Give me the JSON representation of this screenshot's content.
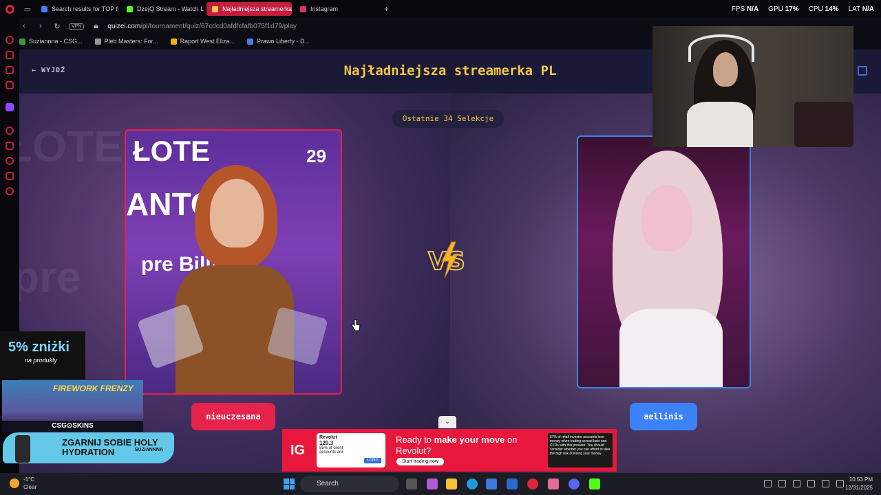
{
  "browser": {
    "tabs": [
      {
        "label": "Search results for TOP fe…",
        "color": "#4f7cff",
        "active": false
      },
      {
        "label": "DzejQ Stream - Watch Liv…",
        "color": "#53fc18",
        "active": false
      },
      {
        "label": "Najładniejsza streamerka…",
        "color": "#f6c64a",
        "active": true
      },
      {
        "label": "Instagram",
        "color": "#e1306c",
        "active": false
      }
    ],
    "new_tab": "+",
    "perf": {
      "fps_label": "FPS",
      "fps": "N/A",
      "gpu_label": "GPU",
      "gpu": "17%",
      "cpu_label": "CPU",
      "cpu": "14%",
      "lat_label": "LAT",
      "lat": "N/A"
    },
    "vpn": "VPN",
    "url_domain": "quizei.com",
    "url_path": "/pl/tournament/quiz/67cdcd0afdfcfafb075f1d79/play",
    "bookmarks": [
      {
        "label": "Suziannna - CSG...",
        "color": "#3a9a3a"
      },
      {
        "label": "Pleb Masters: For...",
        "color": "#999999"
      },
      {
        "label": "Raport West Eliza...",
        "color": "#f2b400"
      },
      {
        "label": "Prawo Liberty - D...",
        "color": "#4a7de0"
      }
    ]
  },
  "quiz": {
    "exit_label": "WYJDŹ",
    "title": "Najładniejsza streamerka PL",
    "counter": "Ostatnie 34 Selekcje",
    "left_name": "nieuczesana",
    "right_name": "aellinis",
    "left_card_sign_1": "ŁOTE",
    "left_card_sign_2": "ANTOSŁ",
    "left_card_sign_3": "pre    Billi",
    "left_card_sign_29": "29",
    "accent_left": "#e6234a",
    "accent_right": "#3c82f6",
    "accent_title": "#f6c64a"
  },
  "ad": {
    "brand": "IG",
    "card_title": "Revolut",
    "card_value": "120.3",
    "card_note": "85% of client accounts are",
    "card_button": "LONG",
    "headline_pre": "Ready to ",
    "headline_bold": "make your move",
    "headline_post": " on Revolut?",
    "cta": "Start trading now",
    "risk": "67% of retail investor accounts lose money when trading spread bets and CFDs with this provider. You should consider whether you can afford to take the high risk of losing your money."
  },
  "overlays": {
    "promo_big": "5% zniżki",
    "promo_small": "na produkty",
    "game_title": "FIREWORK FRENZY",
    "game_sponsor": "CSG⊙SKINS",
    "hydration_text": "ZGARNIJ SOBIE HOLY HYDRATION",
    "hydration_brand": "SUZIANNNA"
  },
  "taskbar": {
    "weather_temp": "-1°C",
    "weather_desc": "Clear",
    "search_placeholder": "Search",
    "time": "10:53 PM",
    "date": "12/31/2025"
  }
}
